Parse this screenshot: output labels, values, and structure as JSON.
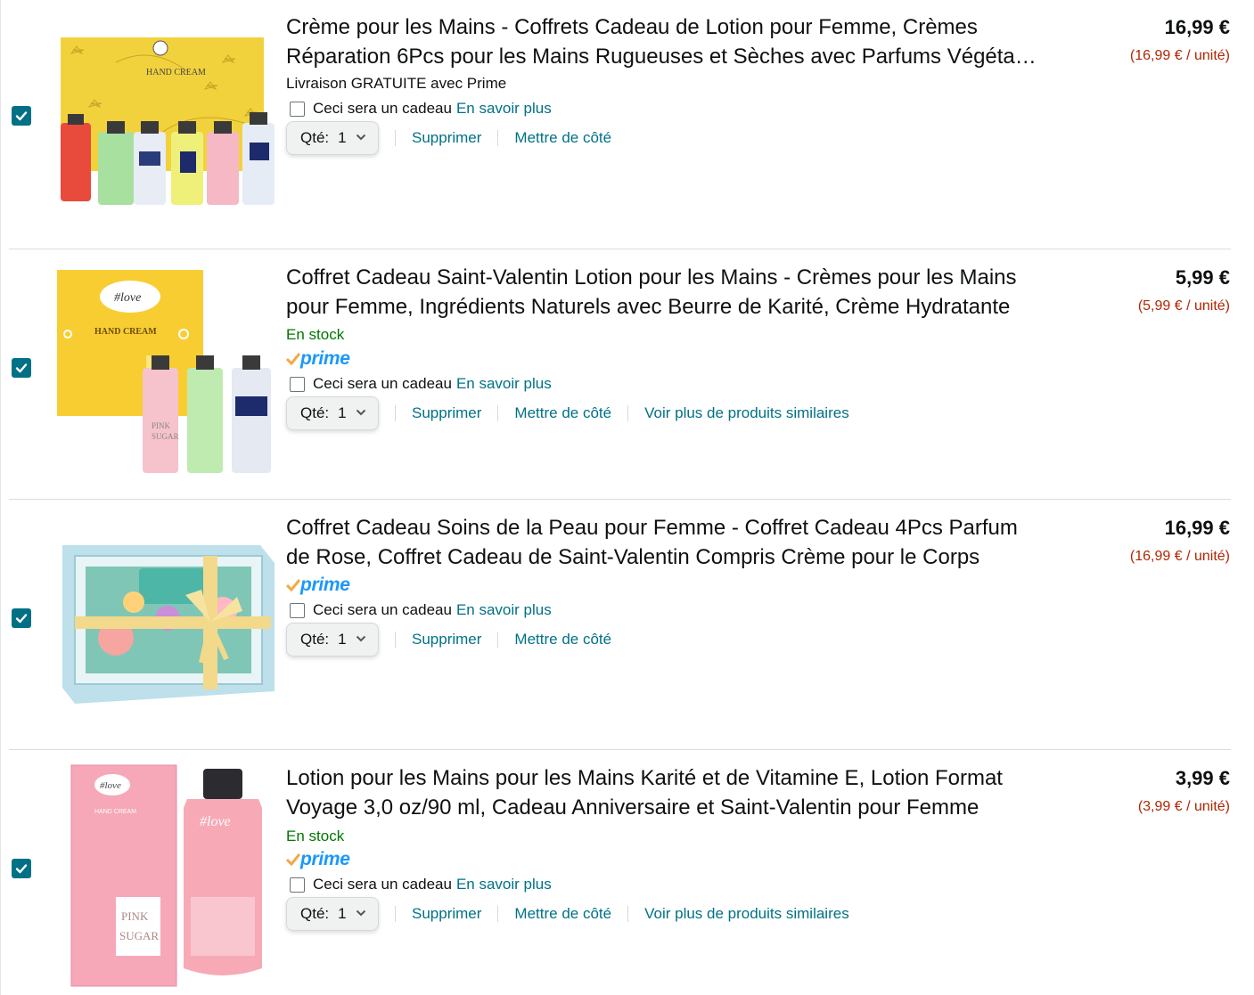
{
  "colors": {
    "accent": "#007185",
    "price_unit": "#b12704",
    "in_stock": "#007600",
    "prime": "#1a98ff",
    "prime_check": "#f3a847"
  },
  "labels": {
    "gift_text": "Ceci sera un cadeau",
    "gift_link": "En savoir plus",
    "qty_label": "Qté:",
    "delete": "Supprimer",
    "save_for_later": "Mettre de côté",
    "see_similar": "Voir plus de produits similaires",
    "prime": "prime"
  },
  "items": [
    {
      "title": "Crème pour les Mains - Coffrets Cadeau de Lotion pour Femme, Crèmes Réparation 6Pcs pour les Mains Rugueuses et Sèches avec Parfums Végétaux Naturels",
      "price": "16,99 €",
      "unit_price": "(16,99 € / unité)",
      "status": "Livraison GRATUITE avec Prime",
      "qty": "1",
      "selected": true,
      "image_icon": "hand-cream-gift-set-6pcs"
    },
    {
      "title": "Coffret Cadeau Saint-Valentin Lotion pour les Mains - Crèmes pour les Mains pour Femme, Ingrédients Naturels avec Beurre de Karité, Crème Hydratante",
      "price": "5,99 €",
      "unit_price": "(5,99 € / unité)",
      "status": "En stock",
      "qty": "1",
      "selected": true,
      "image_icon": "hand-cream-gift-set-3pcs"
    },
    {
      "title": "Coffret Cadeau Soins de la Peau pour Femme - Coffret Cadeau 4Pcs Parfum de Rose, Coffret Cadeau de Saint-Valentin Compris Crème pour le Corps",
      "price": "16,99 €",
      "unit_price": "(16,99 € / unité)",
      "qty": "1",
      "selected": true,
      "image_icon": "rose-skincare-gift-box"
    },
    {
      "title": "Lotion pour les Mains pour les Mains Karité et de Vitamine E, Lotion Format Voyage 3,0 oz/90 ml, Cadeau Anniversaire et Saint-Valentin pour Femme",
      "price": "3,99 €",
      "unit_price": "(3,99 € / unité)",
      "status": "En stock",
      "qty": "1",
      "selected": true,
      "image_icon": "pink-sugar-hand-cream-tube"
    }
  ],
  "image_text": {
    "hand_cream": "HAND CREAM",
    "pink": "PINK",
    "sugar": "SUGAR",
    "love": "#love"
  }
}
